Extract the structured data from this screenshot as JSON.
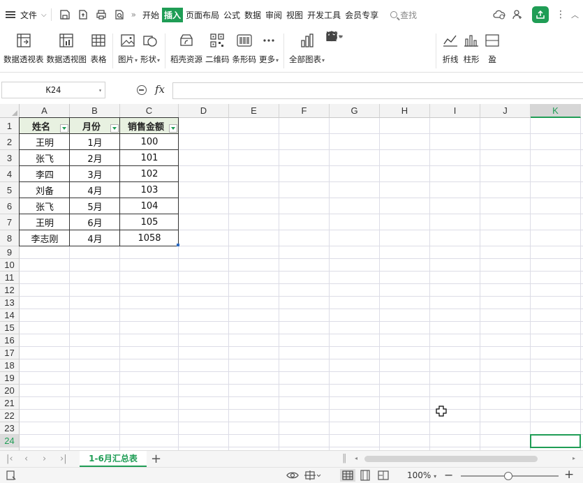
{
  "menubar": {
    "file_label": "文件",
    "tabs": [
      "开始",
      "插入",
      "页面布局",
      "公式",
      "数据",
      "审阅",
      "视图",
      "开发工具",
      "会员专享"
    ],
    "active_tab": "插入",
    "search_label": "查找"
  },
  "ribbon": {
    "items": [
      {
        "label": "数据透视表",
        "icon": "pivot-table-icon"
      },
      {
        "label": "数据透视图",
        "icon": "pivot-chart-icon"
      },
      {
        "label": "表格",
        "icon": "table-icon"
      },
      {
        "label": "图片",
        "icon": "picture-icon",
        "dropdown": true
      },
      {
        "label": "形状",
        "icon": "shapes-icon",
        "dropdown": true
      },
      {
        "label": "稻壳资源",
        "icon": "docer-resource-icon"
      },
      {
        "label": "二维码",
        "icon": "qr-code-icon"
      },
      {
        "label": "条形码",
        "icon": "barcode-icon"
      },
      {
        "label": "更多",
        "icon": "more-icon",
        "dropdown": true
      },
      {
        "label": "全部图表",
        "icon": "all-charts-icon",
        "dropdown": true
      },
      {
        "label": "折线",
        "icon": "line-sparkline-icon"
      },
      {
        "label": "柱形",
        "icon": "column-sparkline-icon"
      },
      {
        "label": "盈",
        "icon": "winloss-sparkline-icon"
      }
    ]
  },
  "formula_bar": {
    "name_box": "K24",
    "fx_label": "fx",
    "formula": ""
  },
  "columns": [
    "A",
    "B",
    "C",
    "D",
    "E",
    "F",
    "G",
    "H",
    "I",
    "J",
    "K"
  ],
  "selected_column": "K",
  "rows": [
    "1",
    "2",
    "3",
    "4",
    "5",
    "6",
    "7",
    "8",
    "9",
    "10",
    "11",
    "12",
    "13",
    "14",
    "15",
    "16",
    "17",
    "18",
    "19",
    "20",
    "21",
    "22",
    "23",
    "24"
  ],
  "selected_row": "24",
  "table": {
    "headers": [
      "姓名",
      "月份",
      "销售金额"
    ],
    "rows": [
      [
        "王明",
        "1月",
        "100"
      ],
      [
        "张飞",
        "2月",
        "101"
      ],
      [
        "李四",
        "3月",
        "102"
      ],
      [
        "刘备",
        "4月",
        "103"
      ],
      [
        "张飞",
        "5月",
        "104"
      ],
      [
        "王明",
        "6月",
        "105"
      ],
      [
        "李志刚",
        "4月",
        "1058"
      ]
    ]
  },
  "sheet_tabs": {
    "active": "1-6月汇总表",
    "add_label": "+"
  },
  "statusbar": {
    "zoom": "100%",
    "zoom_percent": 100
  },
  "colors": {
    "accent": "#1f9d55",
    "header_fill": "#e8f1e1"
  }
}
